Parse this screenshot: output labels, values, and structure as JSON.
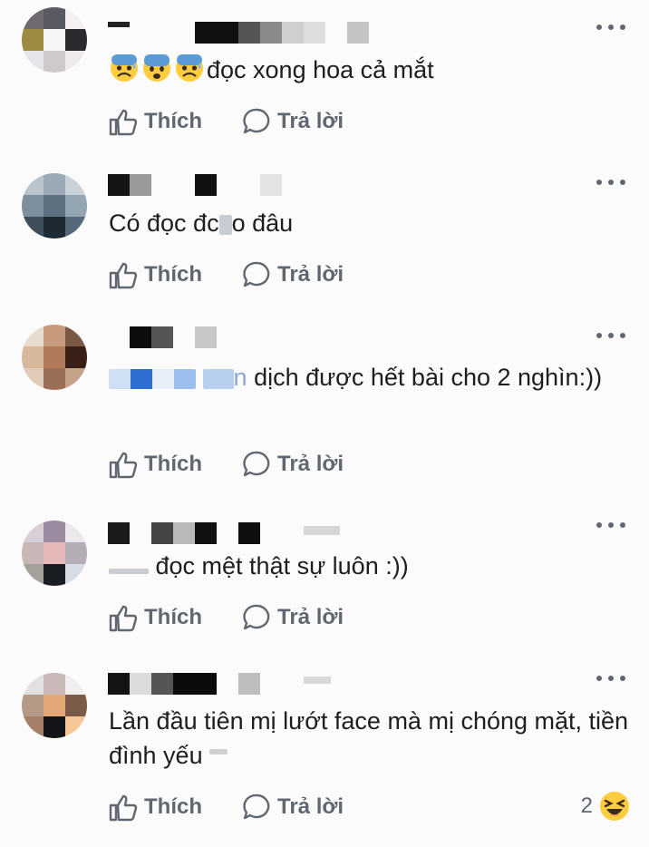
{
  "actions": {
    "like_label": "Thích",
    "reply_label": "Trả lời"
  },
  "comments": [
    {
      "text": "đọc xong hoa cả mắt",
      "emoji_prefix": [
        "anxious-face-with-sweat",
        "fearful-face",
        "anxious-face-with-sweat"
      ]
    },
    {
      "text_before": "Có đọc đc",
      "text_after": "o đâu"
    },
    {
      "text_prefix": "n",
      "text": "dịch được hết bài cho 2 nghìn:))"
    },
    {
      "text": "đọc mệt thật sự luôn :))"
    },
    {
      "text": "Lần đầu tiên mị lướt face mà mị chóng mặt, tiền đình yếu"
    }
  ],
  "reactions": {
    "count": "2",
    "icon": "laughing-face-icon"
  },
  "colors": {
    "muted": "#606770",
    "text": "#1c1e21",
    "background": "#fbfbfb"
  }
}
